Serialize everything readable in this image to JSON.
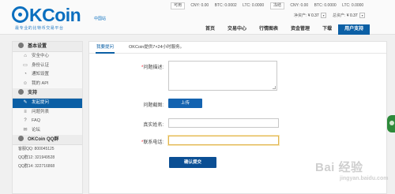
{
  "header": {
    "logo": {
      "wordmark": "KCoin",
      "cn_label": "中国站",
      "tagline": "最专业的比特币交易平台"
    },
    "ticker_left": {
      "tag": "可用",
      "cny": "CNY: 0.00",
      "btc": "BTC: 0.0002",
      "ltc": "LTC: 0.0000"
    },
    "ticker_right": {
      "tag": "冻结",
      "cny": "CNY: 0.00",
      "btc": "BTC: 0.0000",
      "ltc": "LTC: 0.0000"
    },
    "net_assets": {
      "label": "净资产:",
      "value": "¥ 0.37"
    },
    "total_assets": {
      "label": "总资产:",
      "value": "¥ 0.37"
    },
    "nav": [
      "首页",
      "交易中心",
      "行情图表",
      "资金管理",
      "下载",
      "用户支持"
    ]
  },
  "sidebar": {
    "basic_title": "基本设置",
    "basic_items": [
      {
        "icon": "home-icon",
        "label": "安全中心"
      },
      {
        "icon": "id-card-icon",
        "label": "身份认证"
      },
      {
        "icon": "bell-icon",
        "label": "通知设置"
      },
      {
        "icon": "user-icon",
        "label": "我的 API"
      }
    ],
    "support_title": "支持",
    "support_items": [
      {
        "icon": "edit-icon",
        "label": "发起提问"
      },
      {
        "icon": "list-icon",
        "label": "问题列表"
      },
      {
        "icon": "question-icon",
        "label": "FAQ"
      },
      {
        "icon": "forum-icon",
        "label": "论坛"
      }
    ],
    "qq_title": "OKCoin QQ群",
    "qq_groups": [
      "客服QQ: 800045125",
      "QQ群12: 321949528",
      "QQ群14: 322716868"
    ]
  },
  "main": {
    "tab_label": "我要提问",
    "tab_note": "OKCoin提供7×24小时服务。",
    "question_label": "问题描述:",
    "screenshot_label": "问题截图:",
    "upload_label": "上传",
    "name_label": "真实姓名:",
    "phone_label": "联系电话:",
    "name_value": "",
    "phone_value": "",
    "submit_label": "确认提交"
  },
  "watermark": {
    "big": "Bai 经验",
    "small": "jingyan.baidu.com"
  },
  "colors": {
    "brand_blue": "#0b6fbf",
    "nav_active": "#0b5fa5",
    "required": "#e23"
  }
}
